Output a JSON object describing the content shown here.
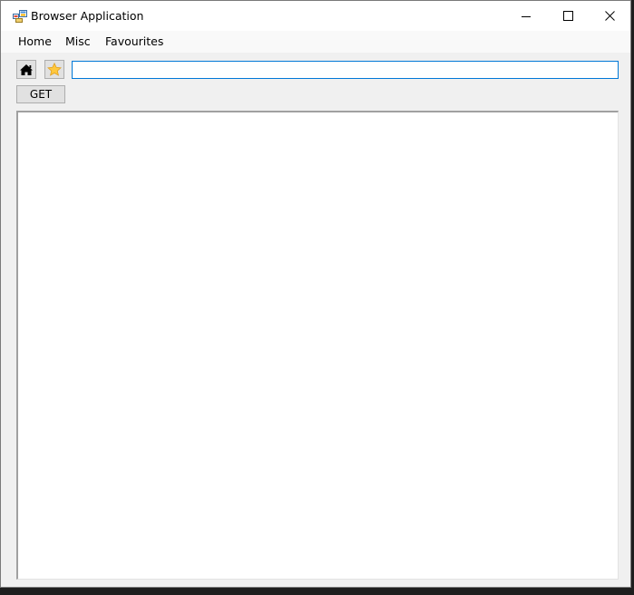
{
  "window": {
    "title": "Browser Application"
  },
  "menu": {
    "home": "Home",
    "misc": "Misc",
    "favourites": "Favourites"
  },
  "toolbar": {
    "home_icon": "home-icon",
    "favourite_icon": "star-icon",
    "url_value": "",
    "get_label": "GET"
  },
  "colors": {
    "window_bg": "#f0f0f0",
    "titlebar_bg": "#ffffff",
    "input_focus_border": "#0078d7",
    "star_fill": "#ffc83d"
  }
}
